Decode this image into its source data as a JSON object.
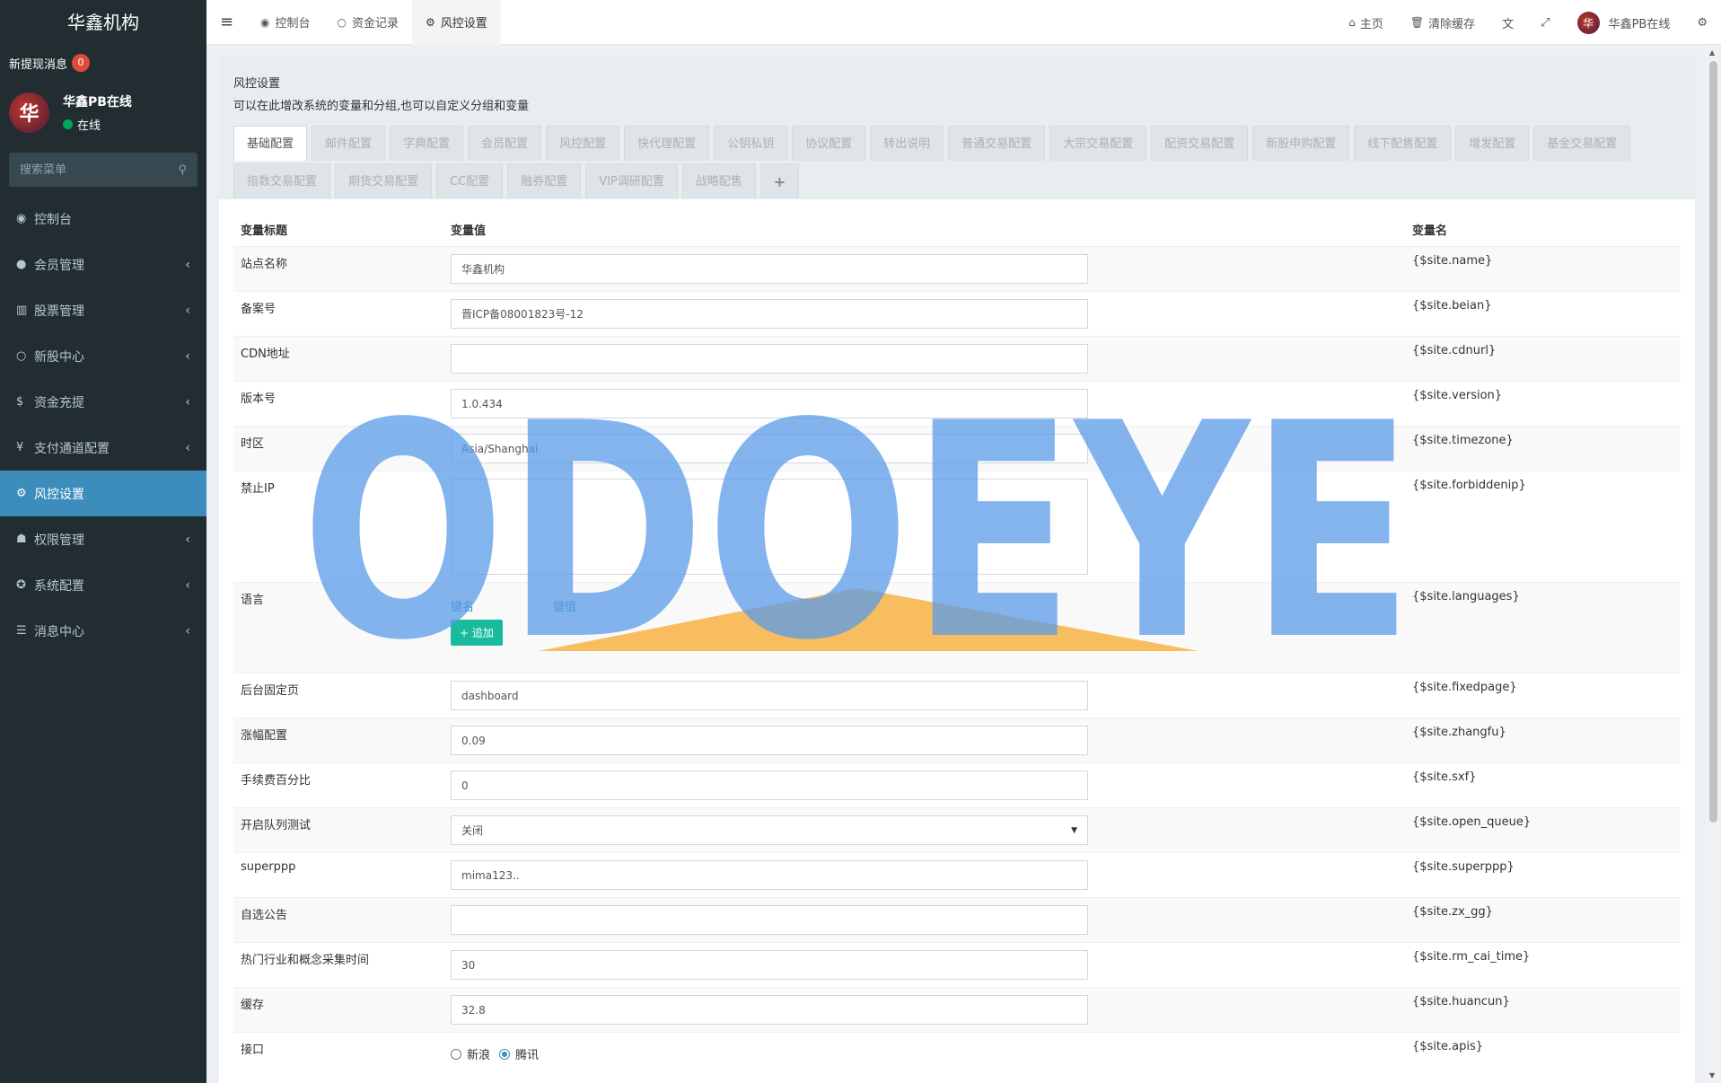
{
  "sidebar": {
    "brand": "华鑫机构",
    "notice_label": "新提现消息",
    "notice_count": "0",
    "user": {
      "avatar_glyph": "华",
      "name": "华鑫PB在线",
      "status": "在线"
    },
    "search_placeholder": "搜索菜单",
    "menu": [
      {
        "label": "控制台",
        "icon": "dashboard-icon",
        "glyph": "◉",
        "arrow": ""
      },
      {
        "label": "会员管理",
        "icon": "user-circle-icon",
        "glyph": "●",
        "arrow": "‹"
      },
      {
        "label": "股票管理",
        "icon": "bank-icon",
        "glyph": "▥",
        "arrow": "‹"
      },
      {
        "label": "新股中心",
        "icon": "circle-icon",
        "glyph": "○",
        "arrow": "‹"
      },
      {
        "label": "资金充提",
        "icon": "dollar-icon",
        "glyph": "$",
        "arrow": "‹"
      },
      {
        "label": "支付通道配置",
        "icon": "yen-icon",
        "glyph": "¥",
        "arrow": "‹"
      },
      {
        "label": "风控设置",
        "icon": "gear-icon",
        "glyph": "⚙",
        "arrow": "",
        "active": true
      },
      {
        "label": "权限管理",
        "icon": "group-icon",
        "glyph": "☗",
        "arrow": "‹"
      },
      {
        "label": "系统配置",
        "icon": "cog-icon",
        "glyph": "✪",
        "arrow": "‹"
      },
      {
        "label": "消息中心",
        "icon": "list-icon",
        "glyph": "☰",
        "arrow": "‹"
      }
    ]
  },
  "header": {
    "tabs": [
      {
        "label": "控制台",
        "glyph": "◉",
        "icon": "dashboard-icon"
      },
      {
        "label": "资金记录",
        "glyph": "○",
        "icon": "circle-icon"
      },
      {
        "label": "风控设置",
        "glyph": "⚙",
        "icon": "gear-icon",
        "active": true
      }
    ],
    "right": {
      "home": "主页",
      "clear_cache": "清除缓存",
      "user": "华鑫PB在线"
    }
  },
  "panel": {
    "title": "风控设置",
    "subtitle": "可以在此增改系统的变量和分组,也可以自定义分组和变量",
    "tabs": [
      "基础配置",
      "邮件配置",
      "字典配置",
      "会员配置",
      "风控配置",
      "快代理配置",
      "公钥私钥",
      "协议配置",
      "转出说明",
      "普通交易配置",
      "大宗交易配置",
      "配资交易配置",
      "新股申购配置",
      "线下配售配置",
      "增发配置",
      "基金交易配置",
      "指数交易配置",
      "期货交易配置",
      "CC配置",
      "融券配置",
      "VIP调研配置",
      "战略配售"
    ],
    "columns": [
      "变量标题",
      "变量值",
      "变量名"
    ],
    "rows": [
      {
        "title": "站点名称",
        "value": "华鑫机构",
        "var": "{$site.name}"
      },
      {
        "title": "备案号",
        "value": "晋ICP备08001823号-12",
        "var": "{$site.beian}"
      },
      {
        "title": "CDN地址",
        "value": "",
        "var": "{$site.cdnurl}"
      },
      {
        "title": "版本号",
        "value": "1.0.434",
        "var": "{$site.version}"
      },
      {
        "title": "时区",
        "value": "Asia/Shanghai",
        "var": "{$site.timezone}"
      },
      {
        "title": "禁止IP",
        "value": "",
        "var": "{$site.forbiddenip}"
      },
      {
        "title": "语言",
        "key_label": "键名",
        "val_label": "键值",
        "add_label": "追加",
        "var": "{$site.languages}"
      },
      {
        "title": "后台固定页",
        "value": "dashboard",
        "var": "{$site.fixedpage}"
      },
      {
        "title": "涨幅配置",
        "value": "0.09",
        "var": "{$site.zhangfu}"
      },
      {
        "title": "手续费百分比",
        "value": "0",
        "var": "{$site.sxf}"
      },
      {
        "title": "开启队列测试",
        "value": "关闭",
        "var": "{$site.open_queue}"
      },
      {
        "title": "superppp",
        "value": "mima123..",
        "var": "{$site.superppp}"
      },
      {
        "title": "自选公告",
        "value": "",
        "var": "{$site.zx_gg}"
      },
      {
        "title": "热门行业和概念采集时间",
        "value": "30",
        "var": "{$site.rm_cai_time}"
      },
      {
        "title": "缓存",
        "value": "32.8",
        "var": "{$site.huancun}"
      },
      {
        "title": "接口",
        "options": [
          "新浪",
          "腾讯"
        ],
        "selected": "腾讯",
        "var": "{$site.apis}"
      }
    ]
  },
  "watermark": "ODOEYE",
  "colors": {
    "sidebar_bg": "#222d32",
    "active_blue": "#3c8dbc",
    "badge_red": "#dd4b39",
    "add_green": "#18bc9c",
    "watermark_blue": "#5a9be8",
    "watermark_orange": "#f8bd5e"
  }
}
